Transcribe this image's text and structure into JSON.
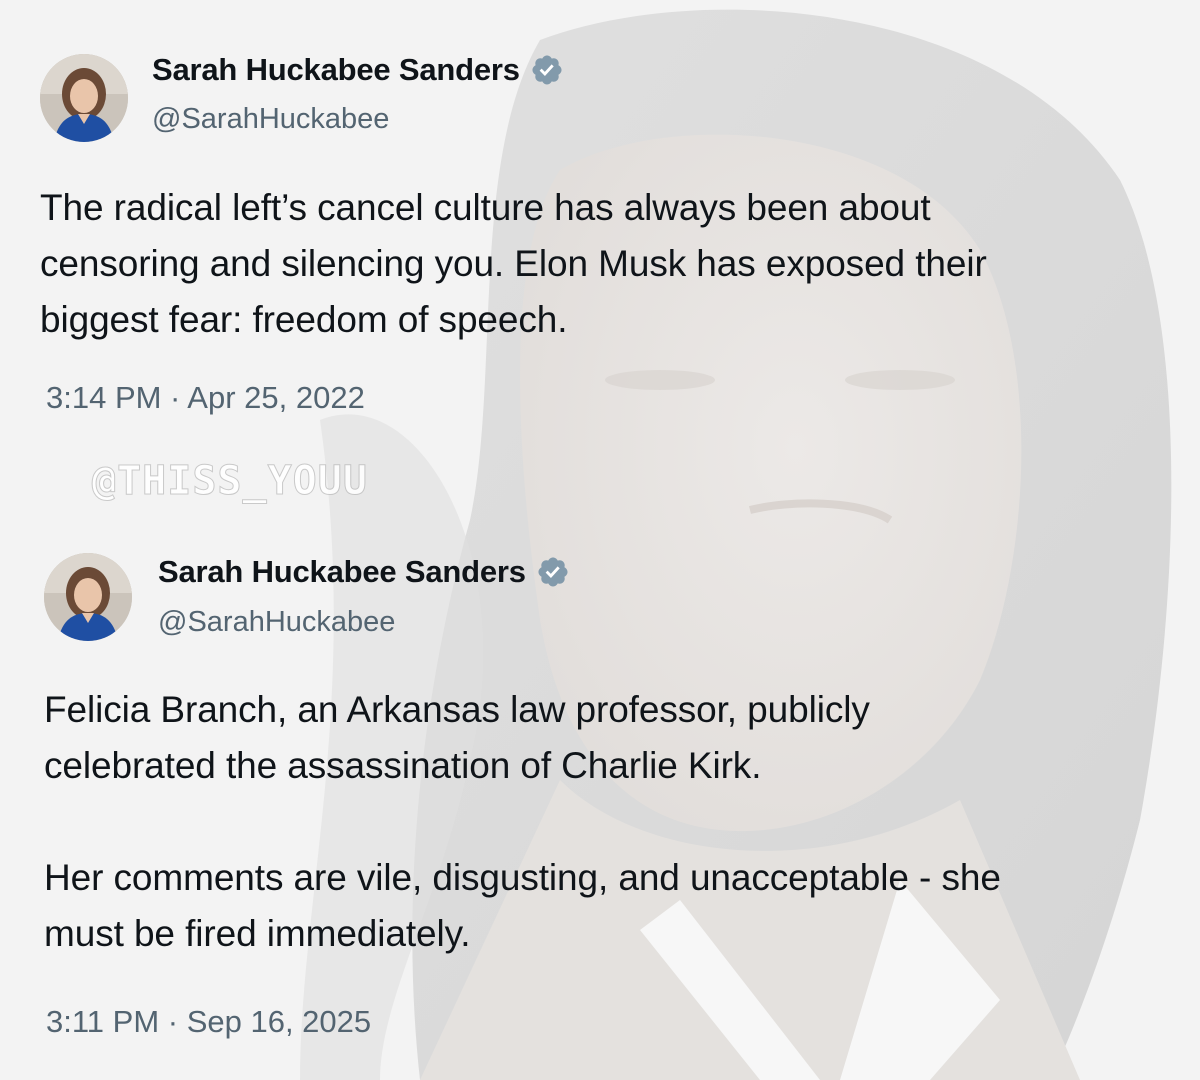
{
  "tweets": [
    {
      "author": {
        "display_name": "Sarah Huckabee Sanders",
        "handle": "@SarahHuckabee",
        "verified_icon": "verified-badge-icon"
      },
      "text": "The radical left’s cancel culture has always been about\ncensoring and silencing you. Elon Musk has exposed their\nbiggest fear: freedom of speech.",
      "timestamp": "3:14 PM · Apr 25, 2022"
    },
    {
      "author": {
        "display_name": "Sarah Huckabee Sanders",
        "handle": "@SarahHuckabee",
        "verified_icon": "verified-badge-icon"
      },
      "text": "Felicia Branch, an Arkansas law professor, publicly\ncelebrated the assassination of Charlie Kirk.\n\nHer comments are vile, disgusting, and unacceptable - she\nmust be fired immediately.",
      "timestamp": "3:11 PM · Sep 16, 2025"
    }
  ],
  "watermark": "@THISS_YOUU",
  "colors": {
    "text_primary": "#0f1419",
    "text_secondary": "#536471",
    "verified_badge": "#829aab",
    "background": "#f3f3f3"
  }
}
